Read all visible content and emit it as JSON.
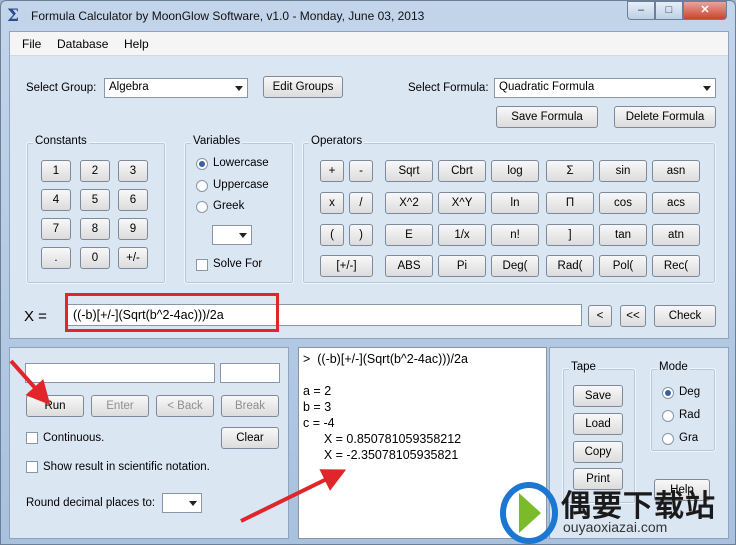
{
  "window": {
    "title": "Formula Calculator by MoonGlow Software, v1.0  -  Monday, June 03, 2013",
    "minimize": "–",
    "maximize": "□",
    "close": "✕"
  },
  "menu": [
    "File",
    "Database",
    "Help"
  ],
  "top": {
    "select_group_label": "Select Group:",
    "select_group_value": "Algebra",
    "edit_groups": "Edit Groups",
    "select_formula_label": "Select Formula:",
    "select_formula_value": "Quadratic Formula",
    "save_formula": "Save Formula",
    "delete_formula": "Delete Formula"
  },
  "constants": {
    "title": "Constants",
    "keys": [
      "1",
      "2",
      "3",
      "4",
      "5",
      "6",
      "7",
      "8",
      "9",
      ".",
      "0",
      "+/-"
    ]
  },
  "variables": {
    "title": "Variables",
    "lowercase": "Lowercase",
    "uppercase": "Uppercase",
    "greek": "Greek",
    "solve_for": "Solve For"
  },
  "operators": {
    "title": "Operators",
    "row1": [
      "+",
      "-",
      "Sqrt",
      "Cbrt",
      "log",
      "Σ",
      "sin",
      "asn"
    ],
    "row2": [
      "x",
      "/",
      "X^2",
      "X^Y",
      "ln",
      "Π",
      "cos",
      "acs"
    ],
    "row3": [
      "(",
      ")",
      "E",
      "1/x",
      "n!",
      "]",
      "tan",
      "atn"
    ],
    "row4": [
      "[+/-]",
      "ABS",
      "Pi",
      "Deg(",
      "Rad(",
      "Pol(",
      "Rec("
    ]
  },
  "expression": {
    "label": "X =",
    "value": "((-b)[+/-](Sqrt(b^2-4ac)))/2a",
    "back": "<",
    "back_all": "<<",
    "check": "Check"
  },
  "run_panel": {
    "run": "Run",
    "enter": "Enter",
    "back": "< Back",
    "break": "Break",
    "continuous": "Continuous.",
    "clear": "Clear",
    "scientific": "Show result in scientific notation.",
    "round_label": "Round decimal places to:"
  },
  "output": {
    "lines": [
      ">  ((-b)[+/-](Sqrt(b^2-4ac)))/2a",
      "",
      "a = 2",
      "b = 3",
      "c = -4",
      "      X = 0.850781059358212",
      "      X = -2.35078105935821"
    ]
  },
  "tape": {
    "title": "Tape",
    "save": "Save",
    "load": "Load",
    "copy": "Copy",
    "print": "Print"
  },
  "mode": {
    "title": "Mode",
    "deg": "Deg",
    "rad": "Rad",
    "gra": "Gra",
    "help": "Help"
  },
  "watermark": {
    "cn": "偶要下载站",
    "en": "ouyaoxiazai.com"
  },
  "colors": {
    "annotation_red": "#e0262a",
    "panel_bg": "#dbe6f3"
  }
}
